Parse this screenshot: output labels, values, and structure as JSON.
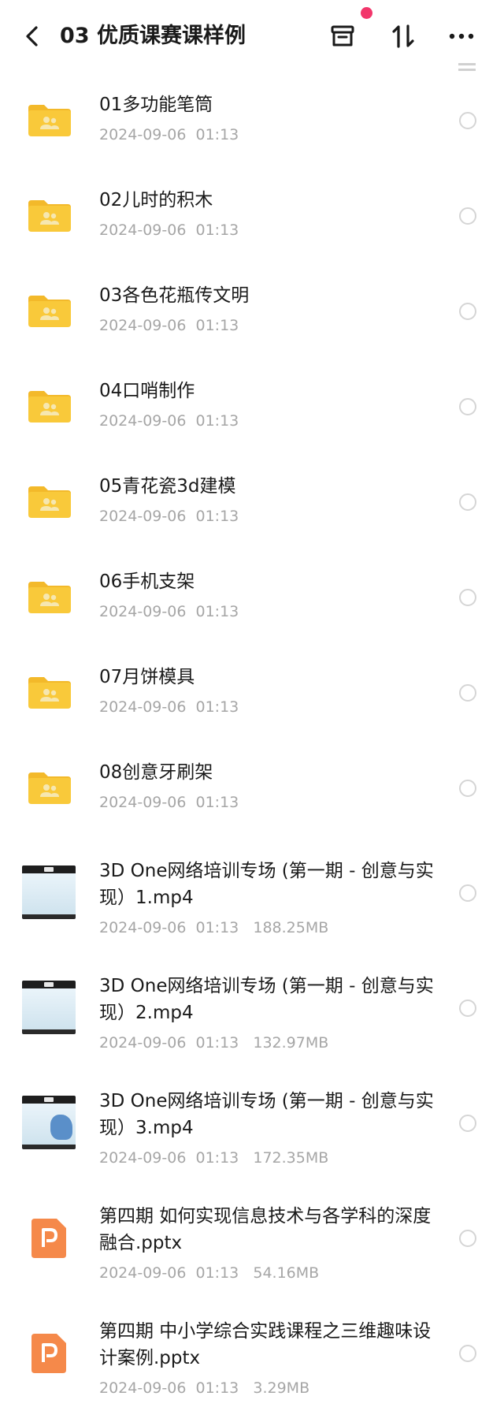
{
  "header": {
    "title": "03 优质课赛课样例",
    "back_icon": "chevron-left-icon",
    "archive_icon": "archive-box-icon",
    "sort_icon": "sort-arrows-icon",
    "more_icon": "more-horizontal-icon",
    "notification_dot_color": "#f2366b"
  },
  "files": [
    {
      "kind": "folder",
      "name": "01多功能笔筒",
      "meta": "2024-09-06  01:13"
    },
    {
      "kind": "folder",
      "name": "02儿时的积木",
      "meta": "2024-09-06  01:13"
    },
    {
      "kind": "folder",
      "name": "03各色花瓶传文明",
      "meta": "2024-09-06  01:13"
    },
    {
      "kind": "folder",
      "name": "04口哨制作",
      "meta": "2024-09-06  01:13"
    },
    {
      "kind": "folder",
      "name": "05青花瓷3d建模",
      "meta": "2024-09-06  01:13"
    },
    {
      "kind": "folder",
      "name": "06手机支架",
      "meta": "2024-09-06  01:13"
    },
    {
      "kind": "folder",
      "name": "07月饼模具",
      "meta": "2024-09-06  01:13"
    },
    {
      "kind": "folder",
      "name": "08创意牙刷架",
      "meta": "2024-09-06  01:13"
    },
    {
      "kind": "video",
      "name": "3D One网络培训专场 (第一期 - 创意与实现）1.mp4",
      "meta": "2024-09-06  01:13   188.25MB"
    },
    {
      "kind": "video",
      "name": "3D One网络培训专场 (第一期 - 创意与实现）2.mp4",
      "meta": "2024-09-06  01:13   132.97MB"
    },
    {
      "kind": "video",
      "name": "3D One网络培训专场 (第一期 - 创意与实现）3.mp4",
      "meta": "2024-09-06  01:13   172.35MB"
    },
    {
      "kind": "ppt",
      "name": "第四期 如何实现信息技术与各学科的深度融合.pptx",
      "meta": "2024-09-06  01:13   54.16MB"
    },
    {
      "kind": "ppt",
      "name": "第四期 中小学综合实践课程之三维趣味设计案例.pptx",
      "meta": "2024-09-06  01:13   3.29MB"
    }
  ],
  "colors": {
    "folder": "#f9c93a",
    "folder_back": "#f3b92a",
    "ppt": "#f5894a",
    "meta_text": "#a6a6a6"
  }
}
